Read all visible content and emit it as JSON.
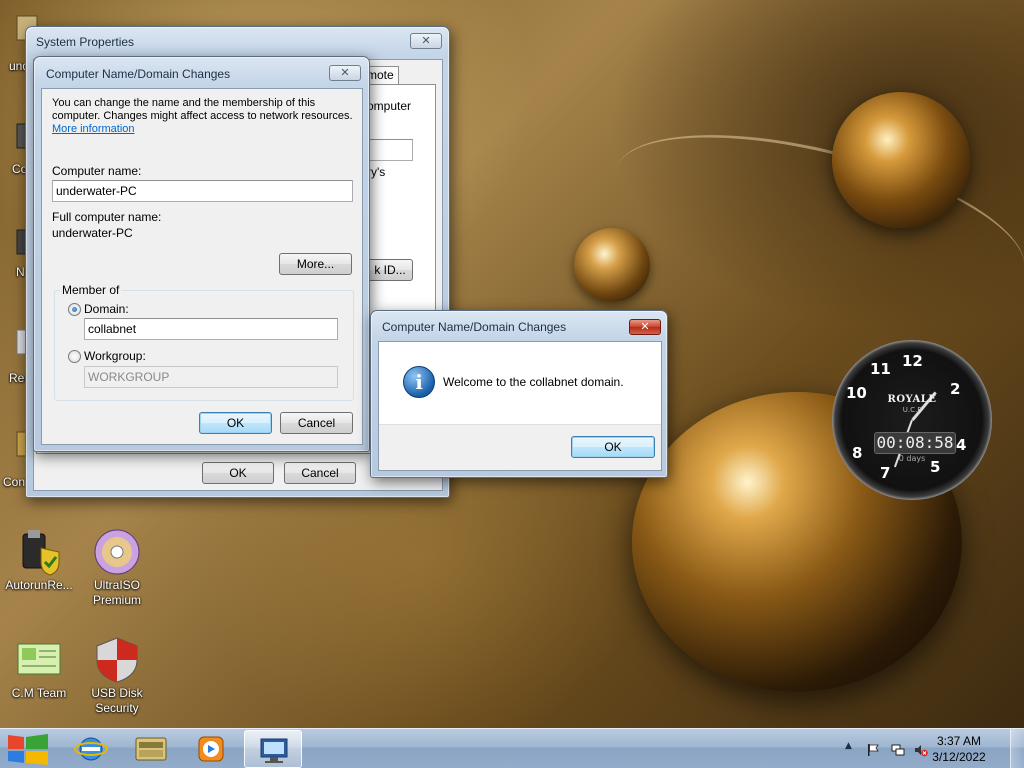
{
  "desktop": {
    "icons": [
      {
        "label_line1": "AutorunRe...",
        "label_line2": ""
      },
      {
        "label_line1": "UltraISO",
        "label_line2": "Premium"
      },
      {
        "label_line1": "C.M Team",
        "label_line2": ""
      },
      {
        "label_line1": "USB Disk",
        "label_line2": "Security"
      }
    ],
    "cut_labels": [
      "und",
      "Co",
      "N",
      "Rec",
      "Con"
    ]
  },
  "clock_gadget": {
    "brand": "ROYALE",
    "brand_sub": "U.C.F",
    "digital_time": "00:08:58",
    "days": "0 days",
    "numerals": [
      "12",
      "2",
      "4",
      "5",
      "7",
      "8",
      "10",
      "11"
    ]
  },
  "system_properties": {
    "title": "System Properties",
    "close_glyph": "✕",
    "tab_partial": "mote",
    "text_partial_1": "omputer",
    "text_partial_2": "ry's",
    "partial_button": "k ID...",
    "ok_label": "OK",
    "cancel_label": "Cancel"
  },
  "name_changes_dialog": {
    "title": "Computer Name/Domain Changes",
    "close_glyph": "✕",
    "intro_line1": "You can change the name and the membership of this",
    "intro_line2": "computer. Changes might affect access to network resources.",
    "more_info_link": "More information",
    "computer_name_label": "Computer name:",
    "computer_name_value": "underwater-PC",
    "full_name_label": "Full computer name:",
    "full_name_value": "underwater-PC",
    "more_button": "More...",
    "member_of_label": "Member of",
    "domain_label": "Domain:",
    "domain_value": "collabnet",
    "workgroup_label": "Workgroup:",
    "workgroup_value": "WORKGROUP",
    "ok_label": "OK",
    "cancel_label": "Cancel"
  },
  "welcome_dialog": {
    "title": "Computer Name/Domain Changes",
    "close_glyph": "✕",
    "message": "Welcome to the collabnet domain.",
    "info_glyph": "i",
    "ok_label": "OK"
  },
  "taskbar": {
    "pinned": [
      "internet-explorer",
      "file-explorer",
      "media-player",
      "system-properties"
    ],
    "tray_chevron": "▲",
    "time": "3:37 AM",
    "date": "3/12/2022"
  },
  "colors": {
    "accent_blue": "#1a5ea8",
    "close_red": "#c9432b",
    "link_blue": "#0066cc"
  }
}
